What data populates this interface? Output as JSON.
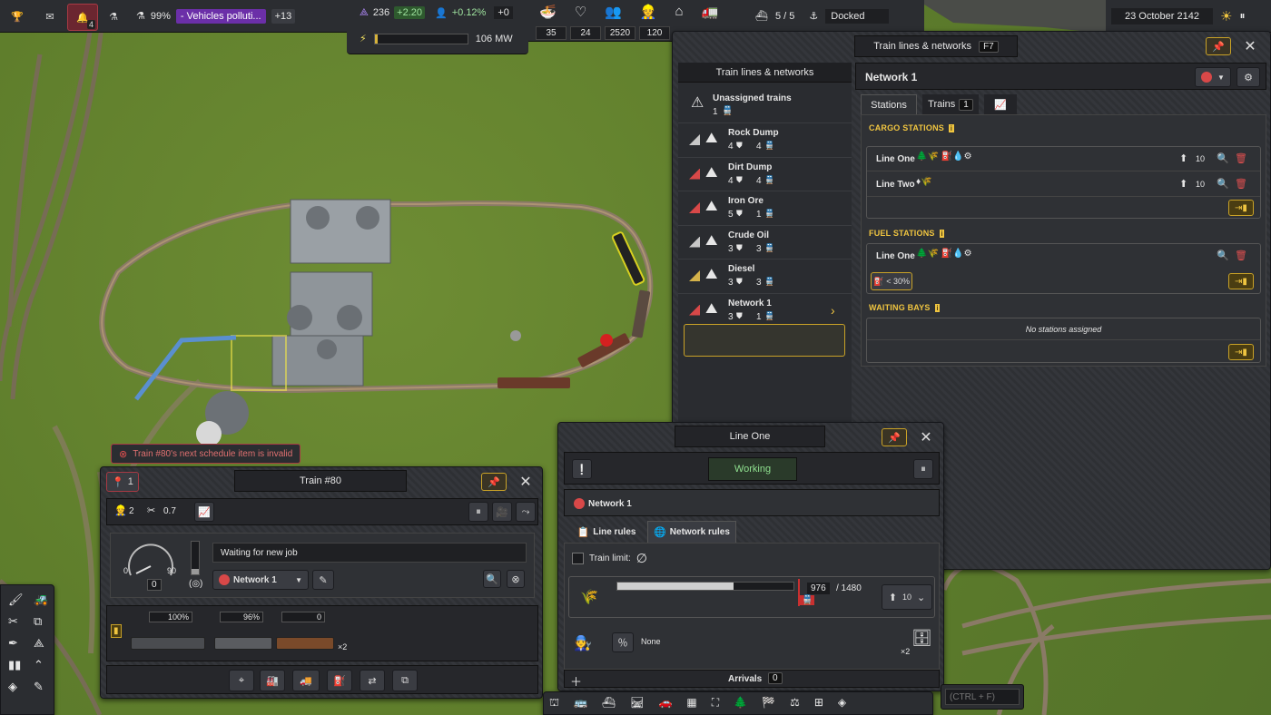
{
  "topbar": {
    "research_pct": "99%",
    "pollution_text": "- Vehicles polluti...",
    "pollution_more": "+13",
    "alerts_count": "4",
    "unity": "236",
    "unity_delta": "+2.20",
    "pop_delta": "+0.12%",
    "pop_change": "+0",
    "power": "106 MW",
    "power_fill": 0.03,
    "stats": [
      "35",
      "24",
      "2520",
      "120"
    ],
    "ships": "5 / 5",
    "ship_status": "Docked",
    "date": "23 October 2142"
  },
  "network_window": {
    "title": "Train lines & networks",
    "hotkey": "F7",
    "list_title": "Train lines & networks",
    "network_name": "Network 1",
    "unassigned": {
      "label": "Unassigned trains",
      "count": "1"
    },
    "items": [
      {
        "name": "Rock Dump",
        "stations": "4",
        "trains": "4",
        "color": "#c8c8c8"
      },
      {
        "name": "Dirt Dump",
        "stations": "4",
        "trains": "4",
        "color": "#d84848"
      },
      {
        "name": "Iron Ore",
        "stations": "5",
        "trains": "1",
        "color": "#d84848"
      },
      {
        "name": "Crude Oil",
        "stations": "3",
        "trains": "3",
        "color": "#c8c8c8"
      },
      {
        "name": "Diesel",
        "stations": "3",
        "trains": "3",
        "color": "#d4b24a"
      },
      {
        "name": "Network 1",
        "stations": "3",
        "trains": "1",
        "color": "#d84848"
      }
    ],
    "tabs": {
      "stations": "Stations",
      "trains": "Trains",
      "trains_count": "1"
    },
    "cargo_title": "CARGO STATIONS",
    "cargo_rows": [
      "Line One",
      "Line Two"
    ],
    "fuel_title": "FUEL STATIONS",
    "fuel_row": "Line One",
    "fuel_threshold": "< 30%",
    "waiting_title": "WAITING BAYS",
    "waiting_empty": "No stations assigned",
    "qty": "10"
  },
  "line_window": {
    "title": "Line One",
    "status": "Working",
    "network": "Network 1",
    "tab_line": "Line rules",
    "tab_network": "Network rules",
    "train_limit": "Train limit:",
    "limit_symbol": "∅",
    "cargo_current": "976",
    "cargo_max": "/ 1480",
    "cargo_fill": 0.66,
    "qty": "10",
    "none": "None",
    "multiplier": "×2",
    "arrivals_label": "Arrivals",
    "arrivals_count": "0"
  },
  "train_window": {
    "alert": "Train #80's next schedule item is invalid",
    "alert_count": "1",
    "title": "Train #80",
    "workers": "2",
    "maintenance": "0.7",
    "speed_min": "0",
    "speed_max": "90",
    "speed_value": "0",
    "status": "Waiting for new job",
    "network": "Network 1",
    "cars": [
      {
        "label": "100%"
      },
      {
        "label": "96%"
      },
      {
        "label": "0"
      }
    ],
    "car_multiplier": "×2"
  },
  "search": {
    "placeholder": "(CTRL + F)"
  }
}
